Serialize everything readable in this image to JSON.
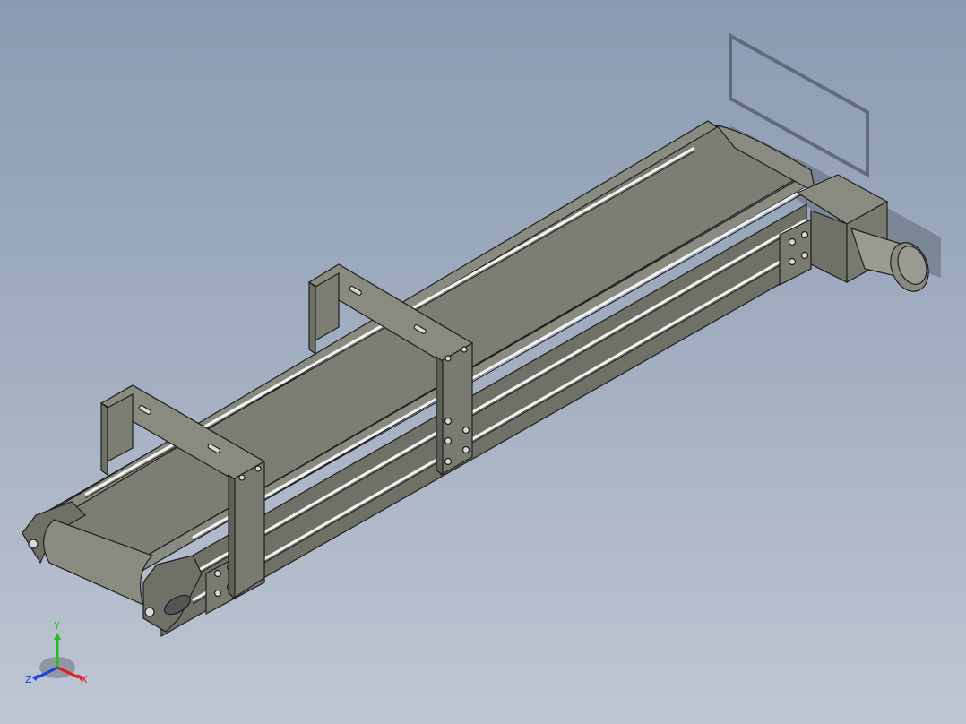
{
  "viewport": {
    "background_top": "#8a9bb1",
    "background_bottom": "#bfc6d3"
  },
  "colors": {
    "frame": "#6f7066",
    "frame_light": "#8a8b80",
    "belt": "#7c7d73",
    "edge": "#1e1e1e",
    "slot": "#f2f2f2",
    "motor": "#9a9a90",
    "shadow": "#3a3f48"
  },
  "triad": {
    "x_label": "X",
    "y_label": "Y",
    "z_label": "Z",
    "x_color": "#e02020",
    "y_color": "#20c020",
    "z_color": "#2040e0"
  }
}
